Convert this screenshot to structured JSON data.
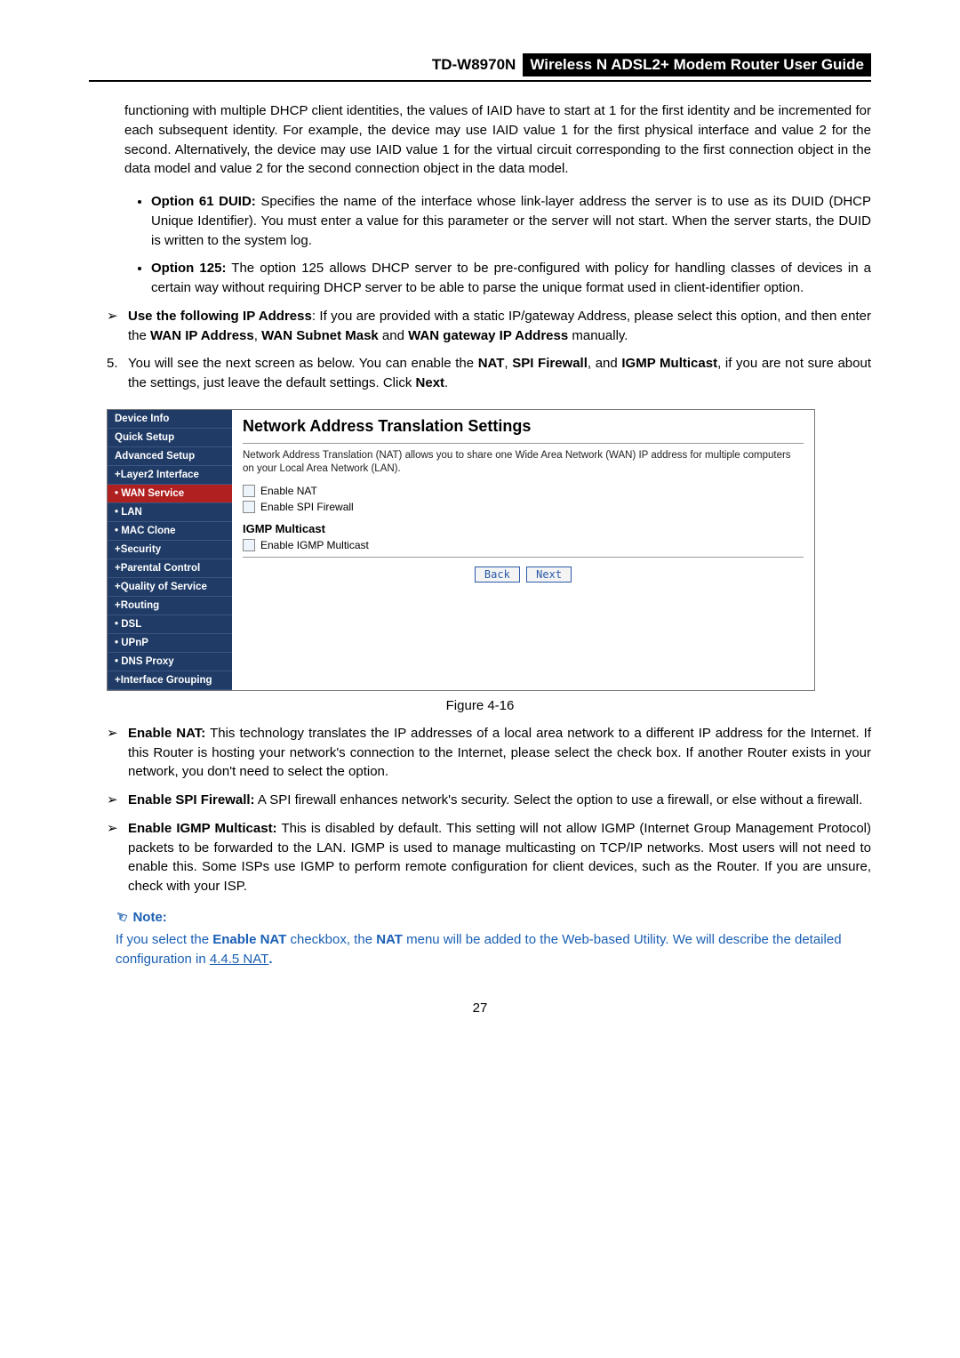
{
  "header": {
    "model": "TD-W8970N",
    "title": "Wireless  N  ADSL2+  Modem  Router  User  Guide"
  },
  "intro_paragraph": "functioning with multiple DHCP client identities, the values of IAID have to start at 1 for the first identity and be incremented for each subsequent identity. For example, the device may use IAID value 1 for the first physical interface and value 2 for the second. Alternatively, the device may use IAID value 1 for the virtual circuit corresponding to the first connection object in the data model and value 2 for the second connection object in the data model.",
  "bullets": [
    {
      "lead": "Option 61 DUID:",
      "text": " Specifies the name of the interface whose link-layer address the server is to use as its DUID (DHCP Unique Identifier). You must enter a value for this parameter or the server will not start. When the server starts, the DUID is written to the system log."
    },
    {
      "lead": "Option 125:",
      "text": " The option 125 allows DHCP server to be pre-configured with policy for handling classes of devices in a certain way without requiring DHCP server to be able to parse the unique format used in client-identifier option."
    }
  ],
  "arrow_use_ip": {
    "lead": "Use the following IP Address",
    "mid": ": If you are provided with a static IP/gateway Address, please select this option, and then enter the ",
    "b1": "WAN IP Address",
    "sep1": ", ",
    "b2": "WAN Subnet Mask",
    "sep2": " and ",
    "b3": "WAN gateway IP Address",
    "tail": " manually."
  },
  "num5": {
    "pre": "You will see the next screen as below. You can enable the ",
    "b1": "NAT",
    "sep1": ", ",
    "b2": "SPI Firewall",
    "sep2": ", and ",
    "b3": "IGMP Multicast",
    "mid": ", if you are not sure about the settings, just leave the default settings. Click ",
    "b4": "Next",
    "tail": "."
  },
  "screenshot": {
    "sidebar": [
      "Device Info",
      "Quick Setup",
      "Advanced Setup",
      "+Layer2 Interface",
      "• WAN Service",
      "• LAN",
      "• MAC Clone",
      "+Security",
      "+Parental Control",
      "+Quality of Service",
      "+Routing",
      "• DSL",
      "• UPnP",
      "• DNS Proxy",
      "+Interface Grouping"
    ],
    "selected_index": 4,
    "title": "Network Address Translation Settings",
    "desc": "Network Address Translation (NAT) allows you to share one Wide Area Network (WAN) IP address for multiple computers on your Local Area Network (LAN).",
    "chk_nat": "Enable NAT",
    "chk_spi": "Enable SPI Firewall",
    "igmp_heading": "IGMP Multicast",
    "chk_igmp": "Enable IGMP Multicast",
    "btn_back": "Back",
    "btn_next": "Next"
  },
  "figure_caption": "Figure 4-16",
  "post_arrows": [
    {
      "lead": "Enable NAT:",
      "text": " This technology translates the IP addresses of a local area network to a different IP address for the Internet. If this Router is hosting your network's connection to the Internet, please select the check box. If another Router exists in your network, you don't need to select the option."
    },
    {
      "lead": "Enable SPI Firewall:",
      "text": " A SPI firewall enhances network's security. Select the option to use a firewall, or else without a firewall."
    },
    {
      "lead": "Enable IGMP Multicast:",
      "text": " This is disabled by default. This setting will not allow IGMP (Internet Group Management Protocol) packets to be forwarded to the LAN. IGMP is used to manage multicasting on TCP/IP networks. Most users will not need to enable this. Some ISPs use IGMP to perform remote configuration for client devices, such as the Router. If you are unsure, check with your ISP."
    }
  ],
  "note": {
    "heading": "Note:",
    "pre": "If you select the ",
    "b1": "Enable NAT",
    "mid1": " checkbox, the ",
    "b2": "NAT",
    "mid2": " menu will be added to the Web-based Utility. We will describe the detailed configuration in ",
    "link": "4.4.5 NAT",
    "tail": "."
  },
  "page_number": "27"
}
